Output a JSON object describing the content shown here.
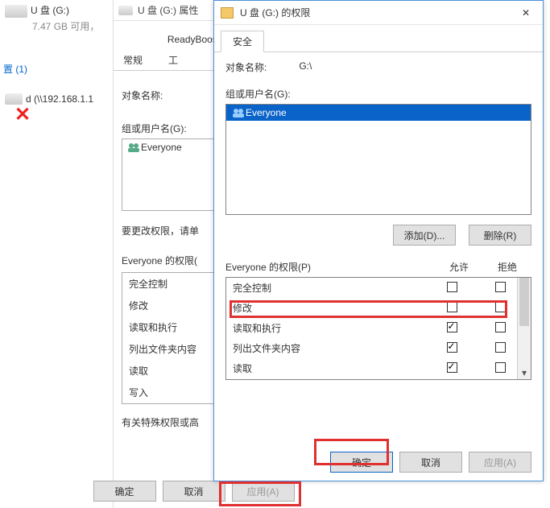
{
  "explorer": {
    "drive_name": "U 盘 (G:)",
    "drive_size": "7.47 GB 可用，",
    "location_count": "置 (1)",
    "network_drive": "d (\\\\192.168.1.1"
  },
  "properties": {
    "title": "U 盘 (G:) 属性",
    "readyboost": "ReadyBoost",
    "tab_general": "常规",
    "tab_tools": "工",
    "object_label": "对象名称:",
    "groups_label": "组或用户名(G):",
    "group_everyone": "Everyone",
    "change_hint": "要更改权限，请单",
    "perm_for": "Everyone 的权限(",
    "perms": [
      "完全控制",
      "修改",
      "读取和执行",
      "列出文件夹内容",
      "读取",
      "写入"
    ],
    "special_hint": "有关特殊权限或高",
    "ok": "确定",
    "cancel": "取消",
    "apply": "应用(A)"
  },
  "perm_dialog": {
    "title": "U 盘 (G:) 的权限",
    "tab": "安全",
    "object_label": "对象名称:",
    "object_value": "G:\\",
    "groups_label": "组或用户名(G):",
    "group_everyone": "Everyone",
    "add": "添加(D)...",
    "remove": "删除(R)",
    "perm_for": "Everyone 的权限(P)",
    "col_allow": "允许",
    "col_deny": "拒绝",
    "rows": [
      {
        "name": "完全控制",
        "allow": false,
        "deny": false
      },
      {
        "name": "修改",
        "allow": false,
        "deny": false
      },
      {
        "name": "读取和执行",
        "allow": true,
        "deny": false
      },
      {
        "name": "列出文件夹内容",
        "allow": true,
        "deny": false
      },
      {
        "name": "读取",
        "allow": true,
        "deny": false
      }
    ],
    "ok": "确定",
    "cancel": "取消",
    "apply": "应用(A)"
  }
}
